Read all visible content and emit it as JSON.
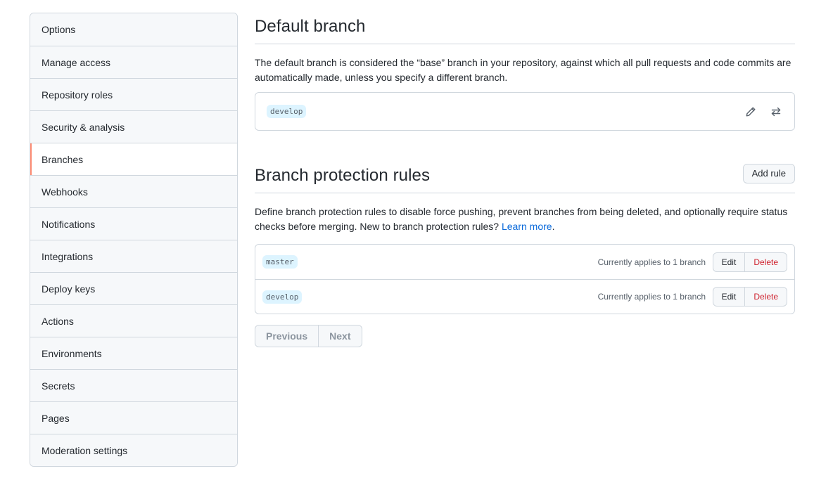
{
  "sidebar": {
    "items": [
      {
        "label": "Options"
      },
      {
        "label": "Manage access"
      },
      {
        "label": "Repository roles"
      },
      {
        "label": "Security & analysis"
      },
      {
        "label": "Branches",
        "selected": true
      },
      {
        "label": "Webhooks"
      },
      {
        "label": "Notifications"
      },
      {
        "label": "Integrations"
      },
      {
        "label": "Deploy keys"
      },
      {
        "label": "Actions"
      },
      {
        "label": "Environments"
      },
      {
        "label": "Secrets"
      },
      {
        "label": "Pages"
      },
      {
        "label": "Moderation settings"
      }
    ]
  },
  "default_branch": {
    "title": "Default branch",
    "description": "The default branch is considered the “base” branch in your repository, against which all pull requests and code commits are automatically made, unless you specify a different branch.",
    "branch": "develop",
    "icons": [
      "pencil-icon",
      "arrow-switch-icon"
    ]
  },
  "protection": {
    "title": "Branch protection rules",
    "add_rule_label": "Add rule",
    "description": "Define branch protection rules to disable force pushing, prevent branches from being deleted, and optionally require status checks before merging. New to branch protection rules?",
    "learn_more": "Learn more",
    "rules": [
      {
        "branch": "master",
        "applies": "Currently applies to 1 branch",
        "edit": "Edit",
        "delete": "Delete"
      },
      {
        "branch": "develop",
        "applies": "Currently applies to 1 branch",
        "edit": "Edit",
        "delete": "Delete"
      }
    ],
    "pager": {
      "previous": "Previous",
      "next": "Next"
    }
  },
  "colors": {
    "accent_selected": "#fd8c73",
    "link": "#0969da",
    "danger": "#cf222e",
    "branch_tag_bg": "#ddf4ff"
  }
}
